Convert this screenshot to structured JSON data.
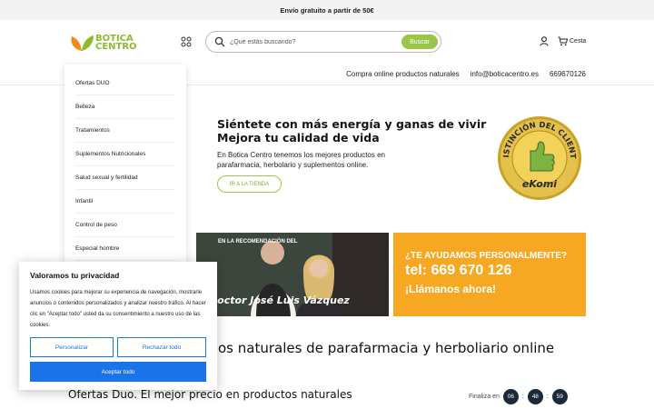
{
  "topbar": {
    "text": "Envío gratuito a partir de 50€"
  },
  "header": {
    "logo_text_line1": "BOTICA",
    "logo_text_line2": "CENTRO",
    "search": {
      "placeholder": "¿Qué estás buscando?",
      "button_label": "Buscar"
    },
    "cart_label": "Cesta",
    "nav_links": [
      "Compra online productos naturales",
      "info@boticacentro.es",
      "669670126"
    ]
  },
  "category_menu": {
    "items": [
      "Ofertas DUO",
      "Belleza",
      "Tratamientos",
      "Suplementos Nutricionales",
      "Salud sexual y fertilidad",
      "Infantil",
      "Control de peso",
      "Especial hombre"
    ]
  },
  "hero": {
    "title_line1": "Siéntete con más energía y ganas de vivir",
    "title_line2": "Mejora tu calidad de vida",
    "text": "En Botica Centro tenemos los mejores productos en parafarmacia, herbolario y suplementos online.",
    "button": "IR A LA TIENDA",
    "badge": {
      "top_text": "DISTINCIÓN DEL CLIENTE",
      "bottom_text": "eKomi"
    }
  },
  "promos": {
    "photo": {
      "label_top": "EN LA RECOMENDACIÓN DEL",
      "label_name": "Doctor José Luis Vázquez"
    },
    "phone": {
      "line1": "¿TE AYUDAMOS PERSONALMENTE?",
      "line2": "tel: 669 670 126",
      "line3": "¡Llámanos ahora!"
    }
  },
  "section_title": "os naturales de parafarmacia y herboliario online",
  "ofertas": {
    "title": "Ofertas Duo. El mejor precio en productos naturales",
    "countdown_label": "Finaliza en",
    "countdown": [
      "06",
      "48",
      "59"
    ]
  },
  "cookie_banner": {
    "title": "Valoramos tu privacidad",
    "text": "Usamos cookies para mejorar su experiencia de navegación, mostrarle anuncios o contenidos personalizados y analizar nuestro tráfico. Al hacer clic en \"Aceptar todo\" usted da su consentimiento a nuestro uso de las cookies.",
    "customize": "Personalizar",
    "reject": "Rechazar todo",
    "accept": "Aceptar todo"
  },
  "colors": {
    "brand_green": "#9cc64a",
    "accent_orange": "#f7a823",
    "cookie_blue": "#1a73e8",
    "countdown_dark": "#1b2a3a"
  }
}
